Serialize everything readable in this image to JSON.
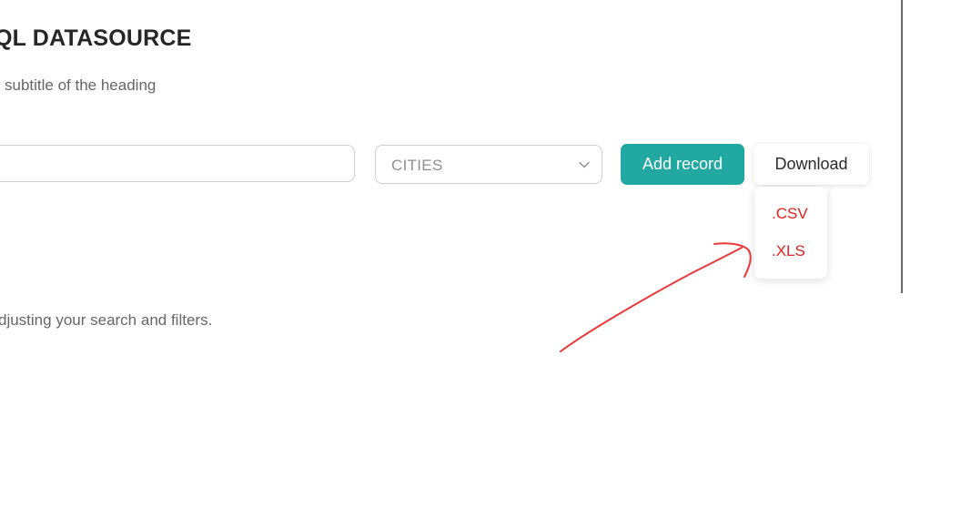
{
  "header": {
    "title": "QL DATASOURCE",
    "subtitle": "subtitle of the heading"
  },
  "toolbar": {
    "search_value": "",
    "select_value": "CITIES",
    "add_label": "Add record",
    "download_label": "Download"
  },
  "download_menu": {
    "items": [
      ".CSV",
      ".XLS"
    ]
  },
  "empty_state": {
    "message": "djusting your search and filters."
  },
  "colors": {
    "accent": "#21a8a0",
    "menu_text": "#e0201f",
    "annotation": "#e83a3a"
  },
  "icons": {
    "select_chevron": "chevron-down-icon"
  }
}
